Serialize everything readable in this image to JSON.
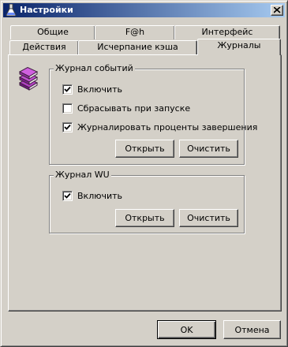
{
  "window": {
    "title": "Настройки"
  },
  "tabs": {
    "row_back": [
      "Общие",
      "F@h",
      "Интерфейс"
    ],
    "row_front": [
      "Действия",
      "Исчерпание кэша",
      "Журналы"
    ],
    "active": "Журналы"
  },
  "event_log": {
    "title": "Журнал событий",
    "options": [
      {
        "label": "Включить",
        "checked": true
      },
      {
        "label": "Сбрасывать при запуске",
        "checked": false
      },
      {
        "label": "Журналировать проценты завершения",
        "checked": true
      }
    ],
    "open_label": "Открыть",
    "clear_label": "Очистить"
  },
  "wu_log": {
    "title": "Журнал WU",
    "options": [
      {
        "label": "Включить",
        "checked": true
      }
    ],
    "open_label": "Открыть",
    "clear_label": "Очистить"
  },
  "footer": {
    "ok_label": "OK",
    "cancel_label": "Отмена"
  }
}
